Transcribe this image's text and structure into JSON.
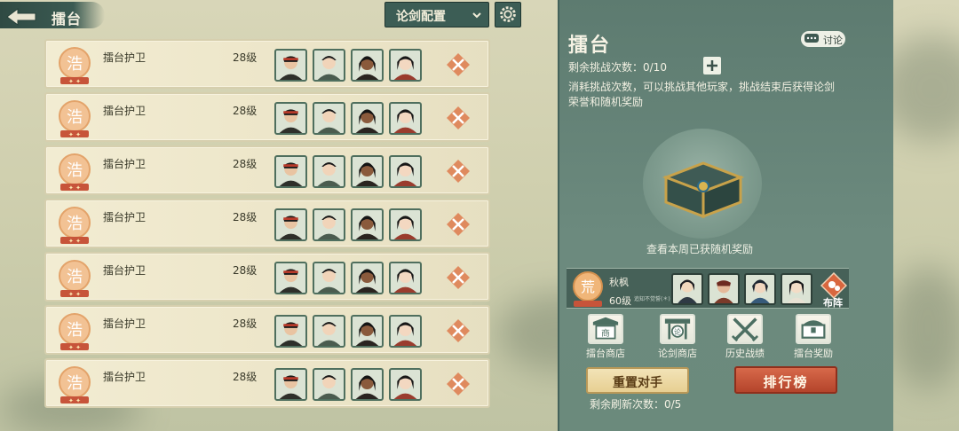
{
  "topbar": {
    "title": "擂台",
    "config_select": "论剑配置"
  },
  "opponents": [
    {
      "name": "擂台护卫",
      "level": "28级",
      "badge_char": "浩",
      "heroes": [
        "hero-portrait-1",
        "hero-portrait-2",
        "hero-portrait-3",
        "hero-portrait-4"
      ]
    },
    {
      "name": "擂台护卫",
      "level": "28级",
      "badge_char": "浩",
      "heroes": [
        "hero-portrait-1",
        "hero-portrait-2",
        "hero-portrait-3",
        "hero-portrait-4"
      ]
    },
    {
      "name": "擂台护卫",
      "level": "28级",
      "badge_char": "浩",
      "heroes": [
        "hero-portrait-1",
        "hero-portrait-2",
        "hero-portrait-3",
        "hero-portrait-4"
      ]
    },
    {
      "name": "擂台护卫",
      "level": "28级",
      "badge_char": "浩",
      "heroes": [
        "hero-portrait-1",
        "hero-portrait-2",
        "hero-portrait-3",
        "hero-portrait-4"
      ]
    },
    {
      "name": "擂台护卫",
      "level": "28级",
      "badge_char": "浩",
      "heroes": [
        "hero-portrait-1",
        "hero-portrait-2",
        "hero-portrait-3",
        "hero-portrait-4"
      ]
    },
    {
      "name": "擂台护卫",
      "level": "28级",
      "badge_char": "浩",
      "heroes": [
        "hero-portrait-1",
        "hero-portrait-2",
        "hero-portrait-3",
        "hero-portrait-4"
      ]
    },
    {
      "name": "擂台护卫",
      "level": "28级",
      "badge_char": "浩",
      "heroes": [
        "hero-portrait-1",
        "hero-portrait-2",
        "hero-portrait-3",
        "hero-portrait-4"
      ]
    }
  ],
  "panel": {
    "title": "擂台",
    "discuss": "讨论",
    "remain_challenges": "剩余挑战次数：0/10",
    "description": "消耗挑战次数，可以挑战其他玩家，挑战结束后获得论剑荣誉和随机奖励",
    "chest_label": "查看本周已获随机奖励",
    "player": {
      "name": "秋枫",
      "level": "60级",
      "badge_char": "荒",
      "small_text": "追知不觉誓(＊)"
    },
    "formation_label": "布阵",
    "shops": [
      {
        "label": "擂台商店",
        "icon": "arena-shop-icon",
        "glyph": "商"
      },
      {
        "label": "论剑商店",
        "icon": "sword-shop-icon",
        "glyph": "论"
      },
      {
        "label": "历史战绩",
        "icon": "crossed-swords-icon",
        "glyph": "⚔"
      },
      {
        "label": "擂台奖励",
        "icon": "reward-chest-icon",
        "glyph": "▣"
      }
    ],
    "reset_button": "重置对手",
    "rank_button": "排行榜",
    "refresh_remain": "剩余刷新次数：0/5"
  },
  "colors": {
    "panel": "#6c8a7e",
    "row_bg": "#f2ecd2",
    "badge": "#e6a46a",
    "rank_btn": "#c2553a",
    "reset_btn": "#ecd9a3"
  }
}
